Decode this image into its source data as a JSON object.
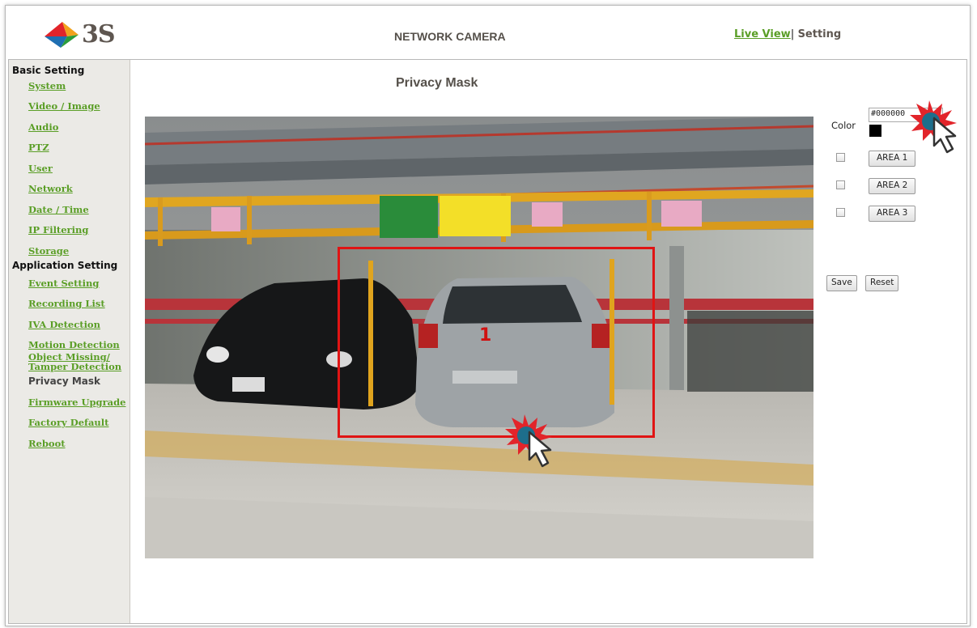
{
  "header": {
    "brand": "3S",
    "app_title": "NETWORK CAMERA",
    "nav_live_view": "Live View",
    "nav_separator": "|",
    "nav_setting": "Setting"
  },
  "sidebar": {
    "basic_section": "Basic Setting",
    "basic_items": [
      "System",
      "Video / Image",
      "Audio",
      "PTZ",
      "User",
      "Network",
      "Date / Time",
      "IP Filtering",
      "Storage"
    ],
    "application_section": "Application Setting",
    "application_items": [
      "Event Setting",
      "Recording List",
      "IVA Detection",
      "Motion Detection",
      "Object Missing/",
      "Tamper Detection",
      "Privacy Mask",
      "Firmware Upgrade",
      "Factory Default",
      "Reboot"
    ],
    "active_item": "Privacy Mask"
  },
  "main": {
    "page_title": "Privacy Mask",
    "mask_number": "1"
  },
  "controls": {
    "color_label": "Color",
    "color_value": "#000000",
    "areas": [
      {
        "label": "AREA 1",
        "checked": false
      },
      {
        "label": "AREA 2",
        "checked": false
      },
      {
        "label": "AREA 3",
        "checked": false
      }
    ],
    "save_label": "Save",
    "reset_label": "Reset"
  },
  "colors": {
    "link_green": "#5a9e26",
    "mask_red": "#e01414",
    "sidebar_bg": "#ebeae6"
  }
}
